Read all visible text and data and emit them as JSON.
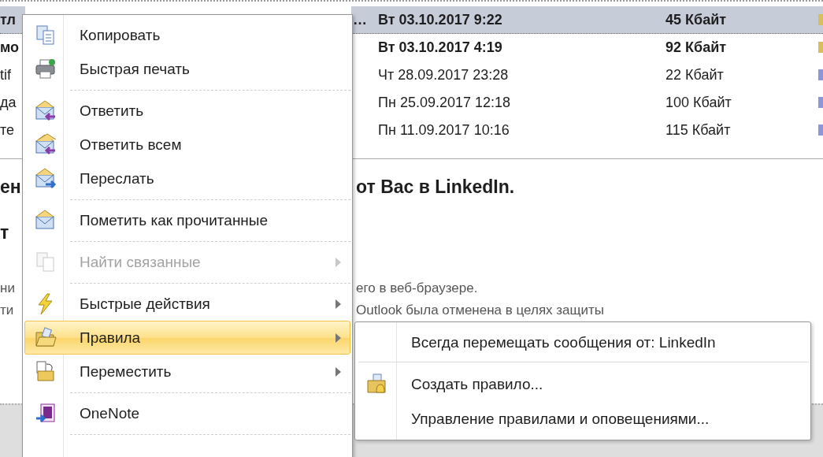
{
  "mail_list": {
    "rows": [
      {
        "subject_start": "тл",
        "subject_end": "…",
        "date": "Вт 03.10.2017 9:22",
        "size": "45 Кбайт",
        "selected": true,
        "unread": true,
        "color": "#d9bf5a"
      },
      {
        "subject_start": "мо",
        "date": "Вт 03.10.2017 4:19",
        "size": "92 Кбайт",
        "selected": false,
        "unread": true,
        "color": "#d9bf5a"
      },
      {
        "subject_start": "tif",
        "date": "Чт 28.09.2017 23:28",
        "size": "22 Кбайт",
        "selected": false,
        "unread": false,
        "color": "#8e95d8"
      },
      {
        "subject_start": "да",
        "date": "Пн 25.09.2017 12:18",
        "size": "100 Кбайт",
        "selected": false,
        "unread": false,
        "color": "#8e95d8"
      },
      {
        "subject_start": "те",
        "date": "Пн 11.09.2017 10:16",
        "size": "115 Кбайт",
        "selected": false,
        "unread": false,
        "color": "#8e95d8"
      }
    ]
  },
  "preview": {
    "heading_start": "ен",
    "heading_end": "от Вас в LinkedIn.",
    "line_start": "т",
    "body": [
      {
        "start": "ни",
        "end": "его в веб-браузере."
      },
      {
        "start": "ти",
        "end": "Outlook была отменена в целях защиты"
      }
    ]
  },
  "context_menu": {
    "items": [
      {
        "kind": "item",
        "label": "Копировать",
        "disabled": false,
        "submenu": false,
        "selected": false
      },
      {
        "kind": "item",
        "label": "Быстрая печать",
        "disabled": false,
        "submenu": false,
        "selected": false
      },
      {
        "kind": "separator"
      },
      {
        "kind": "item",
        "label": "Ответить",
        "disabled": false,
        "submenu": false,
        "selected": false
      },
      {
        "kind": "item",
        "label": "Ответить всем",
        "disabled": false,
        "submenu": false,
        "selected": false
      },
      {
        "kind": "item",
        "label": "Переслать",
        "disabled": false,
        "submenu": false,
        "selected": false
      },
      {
        "kind": "separator"
      },
      {
        "kind": "item",
        "label": "Пометить как прочитанные",
        "disabled": false,
        "submenu": false,
        "selected": false
      },
      {
        "kind": "separator"
      },
      {
        "kind": "item",
        "label": "Найти связанные",
        "disabled": true,
        "submenu": true,
        "selected": false
      },
      {
        "kind": "separator"
      },
      {
        "kind": "item",
        "label": "Быстрые действия",
        "disabled": false,
        "submenu": true,
        "selected": false
      },
      {
        "kind": "item",
        "label": "Правила",
        "disabled": false,
        "submenu": true,
        "selected": true
      },
      {
        "kind": "item",
        "label": "Переместить",
        "disabled": false,
        "submenu": true,
        "selected": false
      },
      {
        "kind": "separator"
      },
      {
        "kind": "item",
        "label": "OneNote",
        "disabled": false,
        "submenu": false,
        "selected": false
      },
      {
        "kind": "separator"
      }
    ]
  },
  "submenu": {
    "items": [
      {
        "kind": "item",
        "label": "Всегда перемещать сообщения от: LinkedIn"
      },
      {
        "kind": "separator"
      },
      {
        "kind": "item",
        "label": "Создать правило..."
      },
      {
        "kind": "item",
        "label": "Управление правилами и оповещениями..."
      }
    ]
  }
}
